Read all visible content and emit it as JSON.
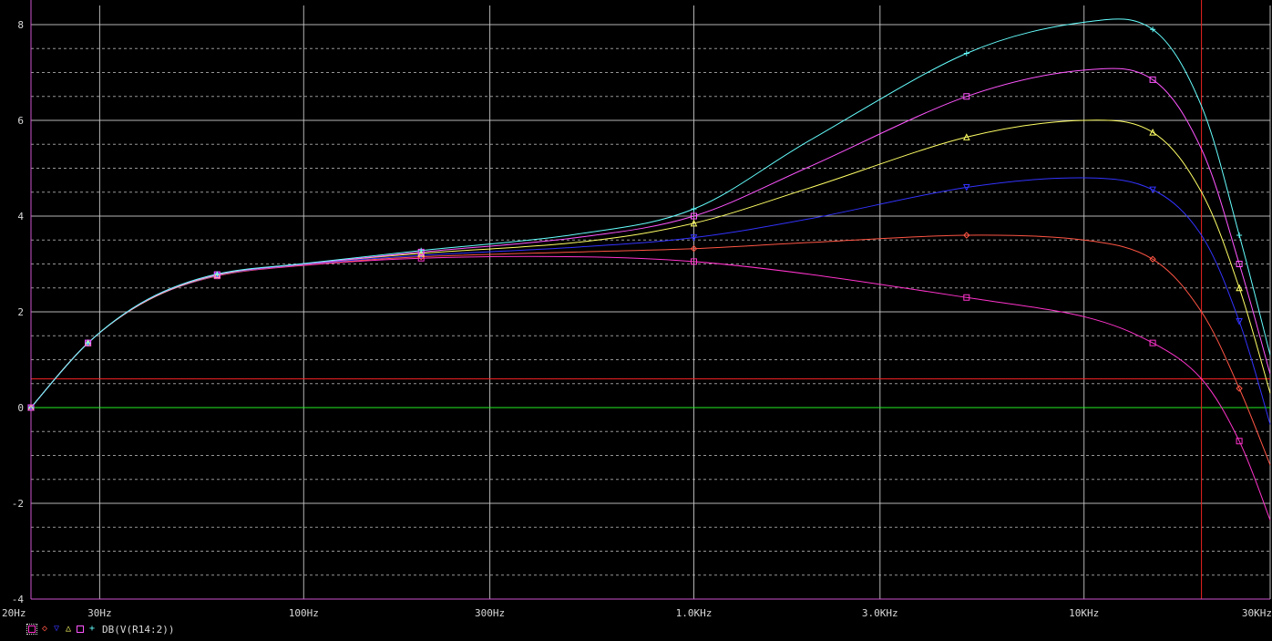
{
  "chart_data": {
    "type": "line",
    "xscale": "log",
    "xlim": [
      20,
      30000
    ],
    "ylim": [
      -4,
      8.5
    ],
    "x_ticks": [
      {
        "value": 20,
        "label": "20Hz"
      },
      {
        "value": 30,
        "label": "30Hz"
      },
      {
        "value": 100,
        "label": "100Hz"
      },
      {
        "value": 300,
        "label": "300Hz"
      },
      {
        "value": 1000,
        "label": "1.0KHz"
      },
      {
        "value": 3000,
        "label": "3.0KHz"
      },
      {
        "value": 10000,
        "label": "10KHz"
      },
      {
        "value": 30000,
        "label": "30KHz"
      }
    ],
    "y_ticks": [
      {
        "value": 8,
        "label": "8"
      },
      {
        "value": 6,
        "label": "6"
      },
      {
        "value": 4,
        "label": "4"
      },
      {
        "value": 2,
        "label": "2"
      },
      {
        "value": 0,
        "label": "0"
      },
      {
        "value": -2,
        "label": "-2"
      },
      {
        "value": -4,
        "label": "-4"
      }
    ],
    "grid": true,
    "series": [
      {
        "color": "#ff33cc",
        "marker": "square",
        "x": [
          20,
          28,
          40,
          60,
          100,
          200,
          500,
          1000,
          2000,
          5000,
          10000,
          15000,
          20000,
          25000,
          30000
        ],
        "values": [
          0,
          1.35,
          2.25,
          2.75,
          2.97,
          3.12,
          3.15,
          3.05,
          2.78,
          2.3,
          1.9,
          1.35,
          0.6,
          -0.7,
          -2.35
        ]
      },
      {
        "color": "#ff5544",
        "marker": "diamond",
        "x": [
          20,
          28,
          40,
          60,
          100,
          200,
          500,
          1000,
          2000,
          5000,
          10000,
          15000,
          20000,
          25000,
          30000
        ],
        "values": [
          0,
          1.35,
          2.25,
          2.75,
          2.98,
          3.15,
          3.25,
          3.32,
          3.45,
          3.6,
          3.5,
          3.1,
          2.0,
          0.4,
          -1.2
        ]
      },
      {
        "color": "#3333ff",
        "marker": "triangle-down",
        "x": [
          20,
          28,
          40,
          60,
          100,
          200,
          500,
          1000,
          2000,
          5000,
          10000,
          15000,
          20000,
          25000,
          30000
        ],
        "values": [
          0,
          1.35,
          2.25,
          2.76,
          2.99,
          3.18,
          3.35,
          3.55,
          3.95,
          4.6,
          4.8,
          4.55,
          3.6,
          1.8,
          -0.35
        ]
      },
      {
        "color": "#ffff66",
        "marker": "triangle",
        "x": [
          20,
          28,
          40,
          60,
          100,
          200,
          500,
          1000,
          2000,
          5000,
          10000,
          15000,
          20000,
          25000,
          30000
        ],
        "values": [
          0,
          1.35,
          2.25,
          2.77,
          3.0,
          3.22,
          3.45,
          3.85,
          4.6,
          5.65,
          6.0,
          5.75,
          4.5,
          2.5,
          0.3
        ]
      },
      {
        "color": "#ff55ff",
        "marker": "square",
        "x": [
          20,
          28,
          40,
          60,
          100,
          200,
          500,
          1000,
          2000,
          5000,
          10000,
          15000,
          20000,
          25000,
          30000
        ],
        "values": [
          0,
          1.35,
          2.26,
          2.78,
          3.0,
          3.25,
          3.55,
          4.0,
          5.05,
          6.5,
          7.05,
          6.85,
          5.4,
          3.0,
          0.7
        ]
      },
      {
        "color": "#66ffff",
        "marker": "plus",
        "x": [
          20,
          28,
          40,
          60,
          100,
          200,
          500,
          1000,
          2000,
          5000,
          10000,
          15000,
          20000,
          25000,
          30000
        ],
        "values": [
          0,
          1.35,
          2.27,
          2.79,
          3.01,
          3.28,
          3.62,
          4.15,
          5.6,
          7.4,
          8.05,
          7.9,
          6.3,
          3.6,
          1.1
        ]
      }
    ],
    "reference_lines": [
      {
        "axis": "y",
        "value": 0,
        "color": "#22ee22"
      },
      {
        "axis": "y",
        "value": 0.6,
        "color": "#ee2222"
      },
      {
        "axis": "x",
        "value": 20000,
        "color": "#ee2222"
      }
    ],
    "legend": {
      "position": "bottom-left",
      "symbols": [
        {
          "marker": "square",
          "color": "#ff33cc"
        },
        {
          "marker": "diamond",
          "color": "#ff5544"
        },
        {
          "marker": "triangle-down",
          "color": "#3333ff"
        },
        {
          "marker": "triangle",
          "color": "#ffff66"
        },
        {
          "marker": "square",
          "color": "#ff55ff"
        },
        {
          "marker": "plus",
          "color": "#66ffff"
        }
      ],
      "trace_name": "DB(V(R14:2))"
    }
  }
}
